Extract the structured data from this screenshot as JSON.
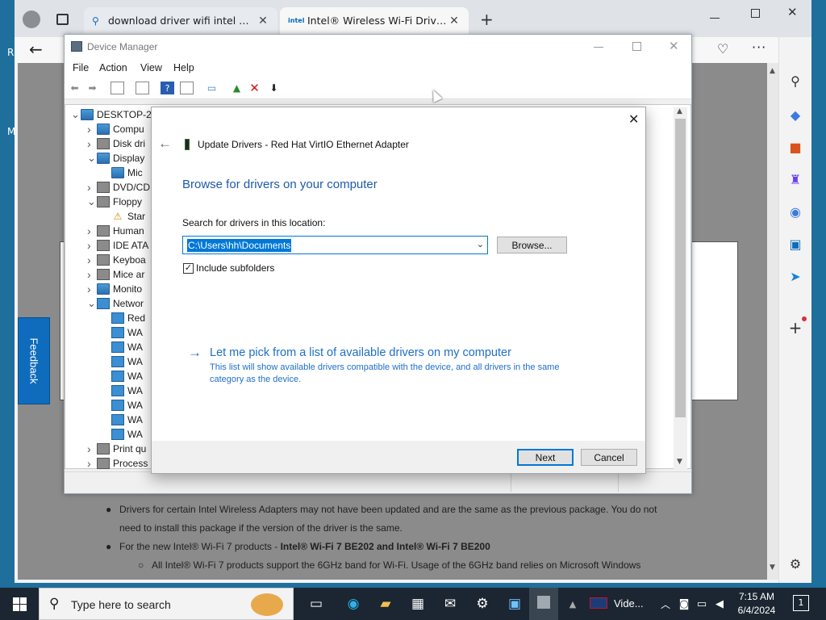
{
  "desktop": {
    "left_edge_letters": [
      "R",
      "M"
    ]
  },
  "browser": {
    "tabs": [
      {
        "title": "download driver wifi intel windo",
        "icon": "search-icon"
      },
      {
        "title": "Intel® Wireless Wi-Fi Drivers for",
        "icon": "intel-logo",
        "favicon_text": "intel"
      }
    ],
    "new_tab_label": "+",
    "feedback_label": "Feedback",
    "page": {
      "bullets": [
        {
          "text": "Drivers for certain Intel Wireless Adapters may not have been updated and are the same as the previous package. You do not",
          "level": 1
        },
        {
          "text": "need to install this package if the version of the driver is the same.",
          "level": 1,
          "continuation": true
        },
        {
          "text_prefix": "For the new Intel® Wi-Fi 7 products - ",
          "text_bold": "Intel® Wi-Fi 7 BE202 and Intel® Wi-Fi 7 BE200",
          "level": 1
        },
        {
          "text": "All Intel® Wi-Fi 7 products support the 6GHz band for Wi-Fi. Usage of the 6GHz band relies on Microsoft Windows",
          "level": 2
        }
      ]
    }
  },
  "device_manager": {
    "title": "Device Manager",
    "menu": [
      "File",
      "Action",
      "View",
      "Help"
    ],
    "tree": [
      {
        "label": "DESKTOP-2",
        "expander": "v",
        "indent": 0,
        "icon": "computer"
      },
      {
        "label": "Compu",
        "expander": ">",
        "indent": 1,
        "icon": "mon"
      },
      {
        "label": "Disk dri",
        "expander": ">",
        "indent": 1,
        "icon": "gen"
      },
      {
        "label": "Display",
        "expander": "v",
        "indent": 1,
        "icon": "mon"
      },
      {
        "label": "Mic",
        "expander": "",
        "indent": 2,
        "icon": "mon"
      },
      {
        "label": "DVD/CD",
        "expander": ">",
        "indent": 1,
        "icon": "gen"
      },
      {
        "label": "Floppy",
        "expander": "v",
        "indent": 1,
        "icon": "gen"
      },
      {
        "label": "Star",
        "expander": "",
        "indent": 2,
        "icon": "warn"
      },
      {
        "label": "Human",
        "expander": ">",
        "indent": 1,
        "icon": "gen"
      },
      {
        "label": "IDE ATA",
        "expander": ">",
        "indent": 1,
        "icon": "gen"
      },
      {
        "label": "Keyboa",
        "expander": ">",
        "indent": 1,
        "icon": "gen"
      },
      {
        "label": "Mice ar",
        "expander": ">",
        "indent": 1,
        "icon": "gen"
      },
      {
        "label": "Monito",
        "expander": ">",
        "indent": 1,
        "icon": "mon"
      },
      {
        "label": "Networ",
        "expander": "v",
        "indent": 1,
        "icon": "net"
      },
      {
        "label": "Red",
        "expander": "",
        "indent": 2,
        "icon": "net"
      },
      {
        "label": "WA",
        "expander": "",
        "indent": 2,
        "icon": "net"
      },
      {
        "label": "WA",
        "expander": "",
        "indent": 2,
        "icon": "net"
      },
      {
        "label": "WA",
        "expander": "",
        "indent": 2,
        "icon": "net"
      },
      {
        "label": "WA",
        "expander": "",
        "indent": 2,
        "icon": "net"
      },
      {
        "label": "WA",
        "expander": "",
        "indent": 2,
        "icon": "net"
      },
      {
        "label": "WA",
        "expander": "",
        "indent": 2,
        "icon": "net"
      },
      {
        "label": "WA",
        "expander": "",
        "indent": 2,
        "icon": "net"
      },
      {
        "label": "WA",
        "expander": "",
        "indent": 2,
        "icon": "net"
      },
      {
        "label": "Print qu",
        "expander": ">",
        "indent": 1,
        "icon": "gen"
      },
      {
        "label": "Process",
        "expander": ">",
        "indent": 1,
        "icon": "gen"
      }
    ]
  },
  "dialog": {
    "title": "Update Drivers - Red Hat VirtIO Ethernet Adapter",
    "heading": "Browse for drivers on your computer",
    "search_label": "Search for drivers in this location:",
    "path_value": "C:\\Users\\hh\\Documents",
    "browse_label": "Browse...",
    "include_subfolders_label": "Include subfolders",
    "include_subfolders_checked": true,
    "pick_link": "Let me pick from a list of available drivers on my computer",
    "pick_desc": "This list will show available drivers compatible with the device, and all drivers in the same category as the device.",
    "next_label": "Next",
    "cancel_label": "Cancel",
    "close_glyph": "✕",
    "back_glyph": "←",
    "link_arrow": "→"
  },
  "taskbar": {
    "search_placeholder": "Type here to search",
    "video_label": "Vide...",
    "time": "7:15 AM",
    "date": "6/4/2024",
    "notifications_count": "1"
  },
  "colors": {
    "accent": "#0078d7",
    "dialog_heading": "#1e5aa8",
    "link": "#0066cc",
    "taskbar": "#1c2632",
    "feedback": "#0f6cbd"
  }
}
